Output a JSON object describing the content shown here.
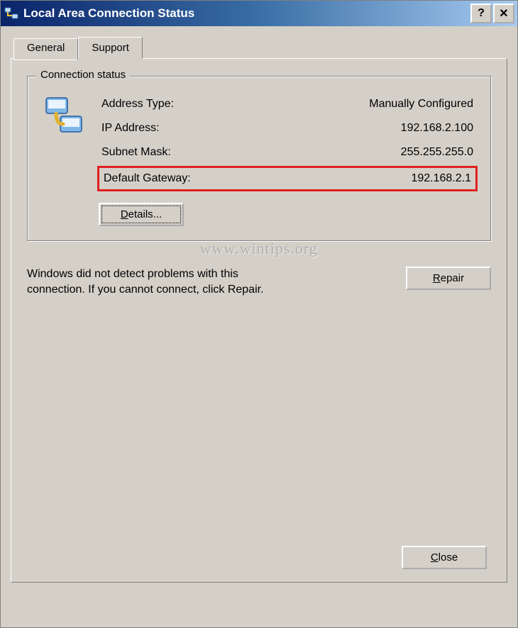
{
  "window": {
    "title": "Local Area Connection Status",
    "help_symbol": "?",
    "close_symbol": "✕"
  },
  "tabs": {
    "general": "General",
    "support": "Support"
  },
  "group": {
    "legend": "Connection status"
  },
  "status": {
    "address_type_label": "Address Type:",
    "address_type_value": "Manually Configured",
    "ip_label": "IP Address:",
    "ip_value": "192.168.2.100",
    "subnet_label": "Subnet Mask:",
    "subnet_value": "255.255.255.0",
    "gateway_label": "Default Gateway:",
    "gateway_value": "192.168.2.1"
  },
  "buttons": {
    "details": "Details...",
    "repair": "Repair",
    "close": "Close"
  },
  "repair_text": "Windows did not detect problems with this connection. If you cannot connect, click Repair.",
  "watermark": "www.wintips.org"
}
